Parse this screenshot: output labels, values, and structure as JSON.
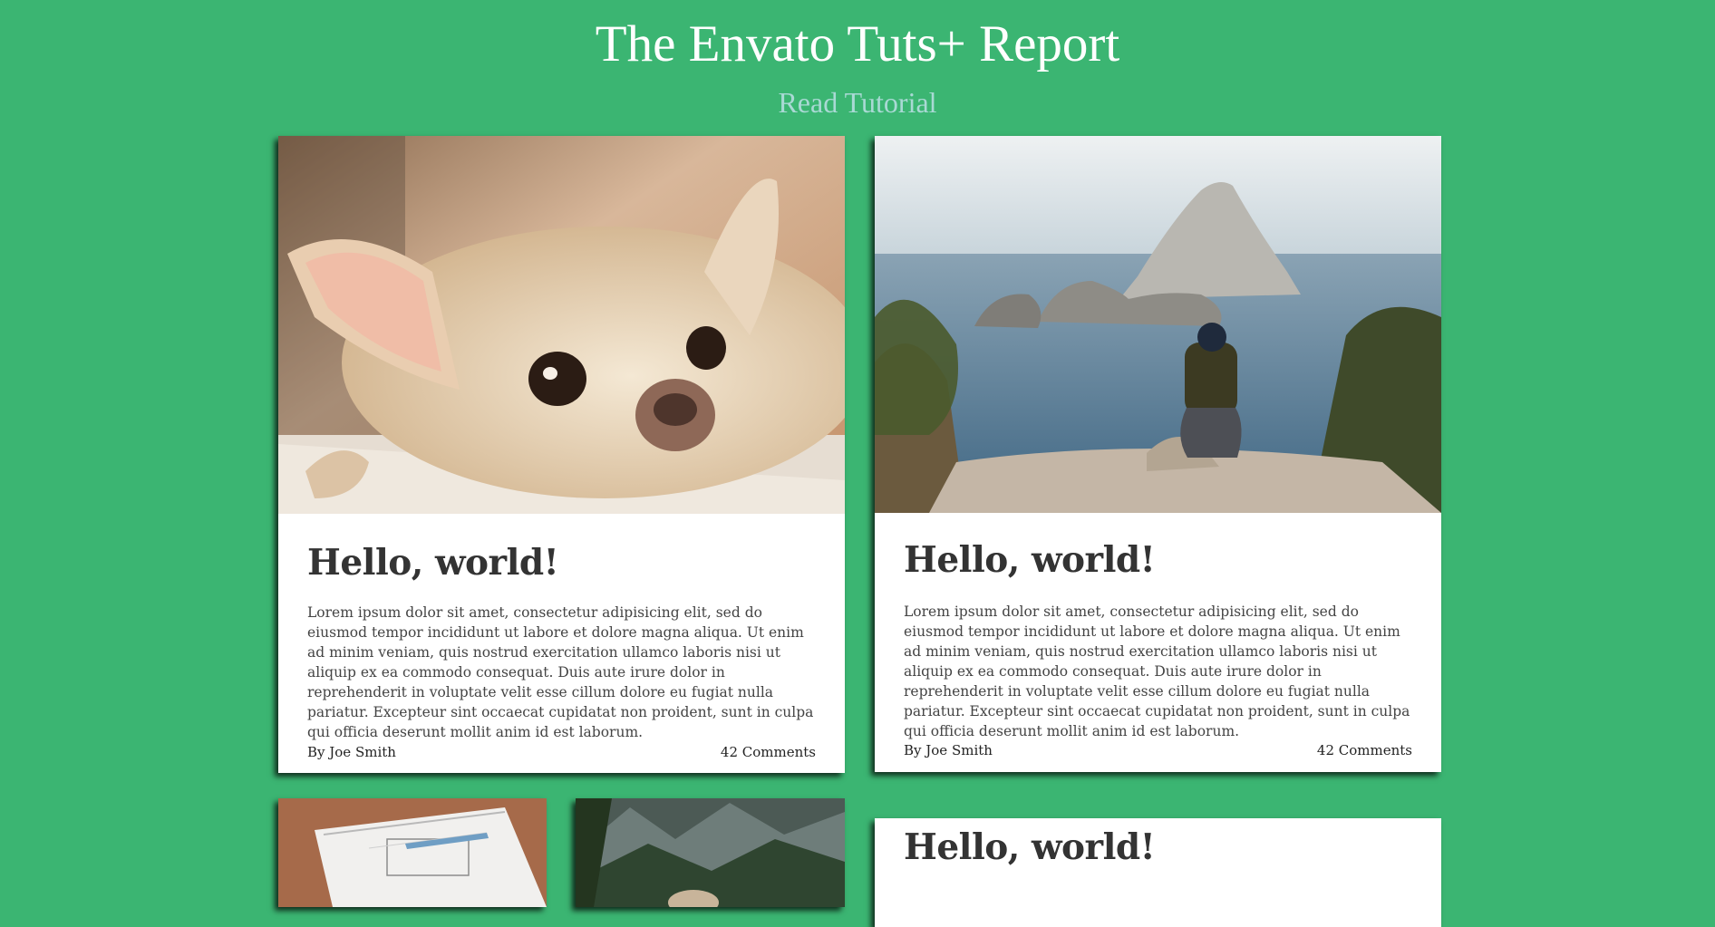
{
  "header": {
    "title": "The Envato Tuts+ Report",
    "link_label": "Read Tutorial"
  },
  "cards": [
    {
      "image": "chihuahua-photo",
      "title": "Hello, world!",
      "text": "Lorem ipsum dolor sit amet, consectetur adipisicing elit, sed do eiusmod tempor incididunt ut labore et dolore magna aliqua. Ut enim ad minim veniam, quis nostrud exercitation ullamco laboris nisi ut aliquip ex ea commodo consequat. Duis aute irure dolor in reprehenderit in voluptate velit esse cillum dolore eu fugiat nulla pariatur. Excepteur sint occaecat cupidatat non proident, sunt in culpa qui officia deserunt mollit anim id est laborum.",
      "author": "By Joe Smith",
      "comments": "42 Comments"
    },
    {
      "image": "island-seaside-photo",
      "title": "Hello, world!",
      "text": "Lorem ipsum dolor sit amet, consectetur adipisicing elit, sed do eiusmod tempor incididunt ut labore et dolore magna aliqua. Ut enim ad minim veniam, quis nostrud exercitation ullamco laboris nisi ut aliquip ex ea commodo consequat. Duis aute irure dolor in reprehenderit in voluptate velit esse cillum dolore eu fugiat nulla pariatur. Excepteur sint occaecat cupidatat non proident, sunt in culpa qui officia deserunt mollit anim id est laborum.",
      "author": "By Joe Smith",
      "comments": "42 Comments"
    },
    {
      "image": "notebook-wireframe-photo"
    },
    {
      "image": "mountain-valley-photo"
    },
    {
      "title": "Hello, world!"
    }
  ],
  "colors": {
    "background": "#3bb572",
    "link": "#a9d9d4",
    "card": "#ffffff",
    "heading": "#333333"
  }
}
